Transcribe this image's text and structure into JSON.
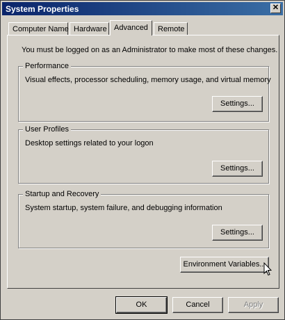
{
  "window": {
    "title": "System Properties",
    "close_glyph": "✕"
  },
  "tabs": [
    {
      "label": "Computer Name",
      "active": false
    },
    {
      "label": "Hardware",
      "active": false
    },
    {
      "label": "Advanced",
      "active": true
    },
    {
      "label": "Remote",
      "active": false
    }
  ],
  "admin_note": "You must be logged on as an Administrator to make most of these changes.",
  "performance": {
    "title": "Performance",
    "description": "Visual effects, processor scheduling, memory usage, and virtual memory",
    "button": "Settings..."
  },
  "user_profiles": {
    "title": "User Profiles",
    "description": "Desktop settings related to your logon",
    "button": "Settings..."
  },
  "startup_recovery": {
    "title": "Startup and Recovery",
    "description": "System startup, system failure, and debugging information",
    "button": "Settings..."
  },
  "env_vars_button": "Environment Variables...",
  "footer": {
    "ok": "OK",
    "cancel": "Cancel",
    "apply": "Apply"
  },
  "colors": {
    "title_start": "#0a246a",
    "title_end": "#3a6ea5",
    "face": "#d4d0c8"
  },
  "icons": {
    "close": "close-icon",
    "cursor": "mouse-pointer-icon"
  }
}
